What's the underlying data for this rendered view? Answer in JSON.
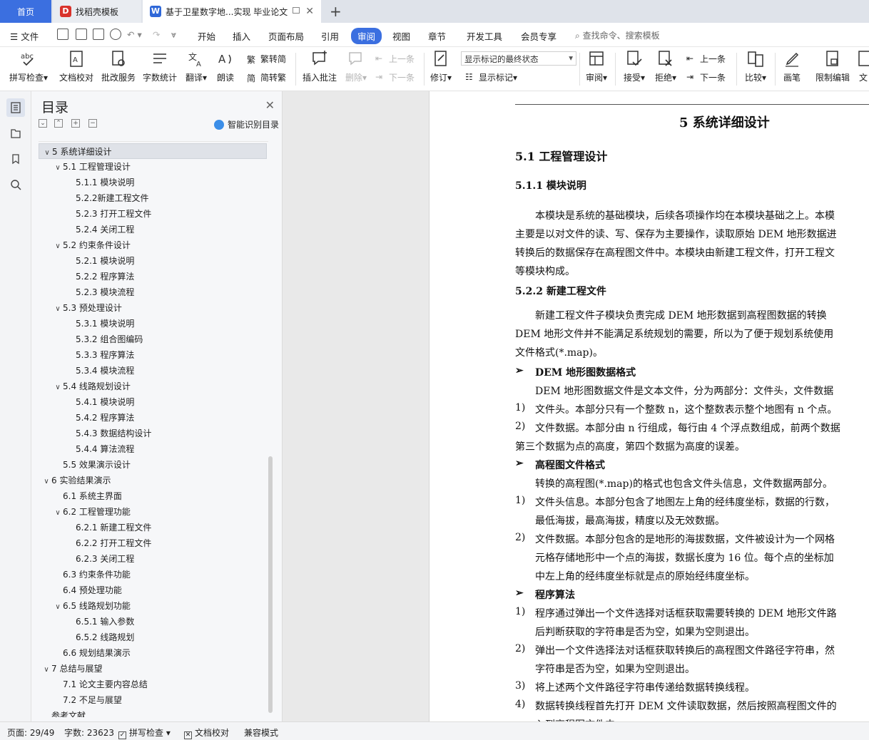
{
  "tabs": {
    "home": "首页",
    "templates": "找稻壳模板",
    "document": "基于卫星数字地...实现 毕业论文"
  },
  "menu": {
    "file": "文件",
    "items": [
      "开始",
      "插入",
      "页面布局",
      "引用",
      "审阅",
      "视图",
      "章节",
      "开发工具",
      "会员专享"
    ],
    "search": "查找命令、搜索模板"
  },
  "ribbon": {
    "spell_check": "拼写检查",
    "doc_proof": "文档校对",
    "review_service": "批改服务",
    "word_count": "字数统计",
    "translate": "翻译",
    "read_aloud": "朗读",
    "trad_to_simp": "繁转简",
    "simp_to_trad": "简转繁",
    "insert_comment": "插入批注",
    "delete": "删除",
    "prev_comment": "上一条",
    "next_comment": "下一条",
    "revise": "修订",
    "markup_state": "显示标记的最终状态",
    "show_markup": "显示标记",
    "review": "审阅",
    "accept": "接受",
    "reject": "拒绝",
    "prev_change": "上一条",
    "next_change": "下一条",
    "compare": "比较",
    "pen": "画笔",
    "restrict_edit": "限制编辑",
    "doc_cut": "文"
  },
  "toc": {
    "title": "目录",
    "smart": "智能识别目录",
    "items": [
      {
        "level": 1,
        "text": "5  系统详细设计",
        "chev": "v",
        "selected": true
      },
      {
        "level": 2,
        "text": "5.1  工程管理设计",
        "chev": "v"
      },
      {
        "level": 3,
        "text": "5.1.1  模块说明"
      },
      {
        "level": 3,
        "text": "5.2.2新建工程文件"
      },
      {
        "level": 3,
        "text": "5.2.3  打开工程文件"
      },
      {
        "level": 3,
        "text": "5.2.4  关闭工程"
      },
      {
        "level": 2,
        "text": "5.2  约束条件设计",
        "chev": "v"
      },
      {
        "level": 3,
        "text": "5.2.1  模块说明"
      },
      {
        "level": 3,
        "text": "5.2.2  程序算法"
      },
      {
        "level": 3,
        "text": "5.2.3  模块流程"
      },
      {
        "level": 2,
        "text": "5.3  预处理设计",
        "chev": "v"
      },
      {
        "level": 3,
        "text": "5.3.1  模块说明"
      },
      {
        "level": 3,
        "text": "5.3.2  组合图编码"
      },
      {
        "level": 3,
        "text": "5.3.3  程序算法"
      },
      {
        "level": 3,
        "text": "5.3.4  模块流程"
      },
      {
        "level": 2,
        "text": "5.4  线路规划设计",
        "chev": "v"
      },
      {
        "level": 3,
        "text": "5.4.1  模块说明"
      },
      {
        "level": 3,
        "text": "5.4.2  程序算法"
      },
      {
        "level": 3,
        "text": "5.4.3  数据结构设计"
      },
      {
        "level": 3,
        "text": "5.4.4  算法流程"
      },
      {
        "level": 2,
        "text": "5.5  效果演示设计"
      },
      {
        "level": 1,
        "text": "6  实验结果演示",
        "chev": "v"
      },
      {
        "level": 2,
        "text": "6.1  系统主界面"
      },
      {
        "level": 2,
        "text": "6.2  工程管理功能",
        "chev": "v"
      },
      {
        "level": 3,
        "text": "6.2.1  新建工程文件"
      },
      {
        "level": 3,
        "text": "6.2.2  打开工程文件"
      },
      {
        "level": 3,
        "text": "6.2.3  关闭工程"
      },
      {
        "level": 2,
        "text": "6.3  约束条件功能"
      },
      {
        "level": 2,
        "text": "6.4  预处理功能"
      },
      {
        "level": 2,
        "text": "6.5  线路规划功能",
        "chev": "v"
      },
      {
        "level": 3,
        "text": "6.5.1  输入参数"
      },
      {
        "level": 3,
        "text": "6.5.2  线路规划"
      },
      {
        "level": 2,
        "text": "6.6  规划结果演示"
      },
      {
        "level": 1,
        "text": "7  总结与展望",
        "chev": "v"
      },
      {
        "level": 2,
        "text": "7.1  论文主要内容总结"
      },
      {
        "level": 2,
        "text": "7.2  不足与展望"
      },
      {
        "level": 1,
        "text": "参考文献"
      }
    ]
  },
  "document": {
    "lines": [
      {
        "cls": "h1",
        "text": "5  系统详细设计",
        "indent": 230
      },
      {
        "cls": "h2",
        "text": "5.1  工程管理设计",
        "indent": 0
      },
      {
        "cls": "h3",
        "text": "5.1.1  模块说明",
        "indent": 0
      },
      {
        "cls": "",
        "text": "本模块是系统的基础模块，后续各项操作均在本模块基础之上。本模",
        "indent": 28
      },
      {
        "cls": "",
        "text": "主要是以对文件的读、写、保存为主要操作，读取原始 DEM 地形数据进",
        "indent": 0
      },
      {
        "cls": "",
        "text": "转换后的数据保存在高程图文件中。本模块由新建工程文件，打开工程文",
        "indent": 0
      },
      {
        "cls": "",
        "text": "等模块构成。",
        "indent": 0
      },
      {
        "cls": "h3",
        "text": "5.2.2    新建工程文件",
        "indent": 0
      },
      {
        "cls": "",
        "text": "新建工程文件子模块负责完成 DEM 地形数据到高程图数据的转换",
        "indent": 28
      },
      {
        "cls": "",
        "text": "DEM 地形文件并不能满足系统规划的需要，所以为了便于规划系统使用",
        "indent": 0
      },
      {
        "cls": "",
        "text": "文件格式(*.map)。",
        "indent": 0
      },
      {
        "cls": "h3",
        "text": "DEM 地形图数据格式",
        "indent": 28,
        "bullet": "➢"
      },
      {
        "cls": "",
        "text": "DEM 地形图数据文件是文本文件，分为两部分：文件头，文件数据",
        "indent": 28
      },
      {
        "cls": "",
        "text": "文件头。本部分只有一个整数 n，这个整数表示整个地图有 n 个点。",
        "indent": 28,
        "bullet": "1)"
      },
      {
        "cls": "",
        "text": "文件数据。本部分由 n 行组成，每行由 4 个浮点数组成，前两个数据",
        "indent": 28,
        "bullet": "2)"
      },
      {
        "cls": "",
        "text": "第三个数据为点的高度，第四个数据为高度的误差。",
        "indent": 0
      },
      {
        "cls": "h3",
        "text": "高程图文件格式",
        "indent": 28,
        "bullet": "➢"
      },
      {
        "cls": "",
        "text": "转换的高程图(*.map)的格式也包含文件头信息，文件数据两部分。",
        "indent": 28
      },
      {
        "cls": "",
        "text": "文件头信息。本部分包含了地图左上角的经纬度坐标，数据的行数，",
        "indent": 28,
        "bullet": "1)"
      },
      {
        "cls": "",
        "text": "最低海拔，最高海拔，精度以及无效数据。",
        "indent": 28
      },
      {
        "cls": "",
        "text": "文件数据。本部分包含的是地形的海拔数据，文件被设计为一个网格",
        "indent": 28,
        "bullet": "2)"
      },
      {
        "cls": "",
        "text": "元格存储地形中一个点的海拔，数据长度为 16 位。每个点的坐标加",
        "indent": 28
      },
      {
        "cls": "",
        "text": "中左上角的经纬度坐标就是点的原始经纬度坐标。",
        "indent": 28
      },
      {
        "cls": "h3",
        "text": "程序算法",
        "indent": 28,
        "bullet": "➢"
      },
      {
        "cls": "",
        "text": "程序通过弹出一个文件选择对话框获取需要转换的 DEM 地形文件路",
        "indent": 28,
        "bullet": "1)"
      },
      {
        "cls": "",
        "text": "后判断获取的字符串是否为空，如果为空则退出。",
        "indent": 28
      },
      {
        "cls": "",
        "text": "弹出一个文件选择法对话框获取转换后的高程图文件路径字符串，然",
        "indent": 28,
        "bullet": "2)"
      },
      {
        "cls": "",
        "text": "字符串是否为空，如果为空则退出。",
        "indent": 28
      },
      {
        "cls": "",
        "text": "将上述两个文件路径字符串传递给数据转换线程。",
        "indent": 28,
        "bullet": "3)"
      },
      {
        "cls": "",
        "text": "数据转换线程首先打开 DEM 文件读取数据，然后按照高程图文件的",
        "indent": 28,
        "bullet": "4)"
      },
      {
        "cls": "",
        "text": "入到高程图文件中。",
        "indent": 28
      }
    ]
  },
  "status": {
    "page": "页面: 29/49",
    "words": "字数: 23623",
    "spell": "拼写检查",
    "proof": "文档校对",
    "compat": "兼容模式"
  }
}
